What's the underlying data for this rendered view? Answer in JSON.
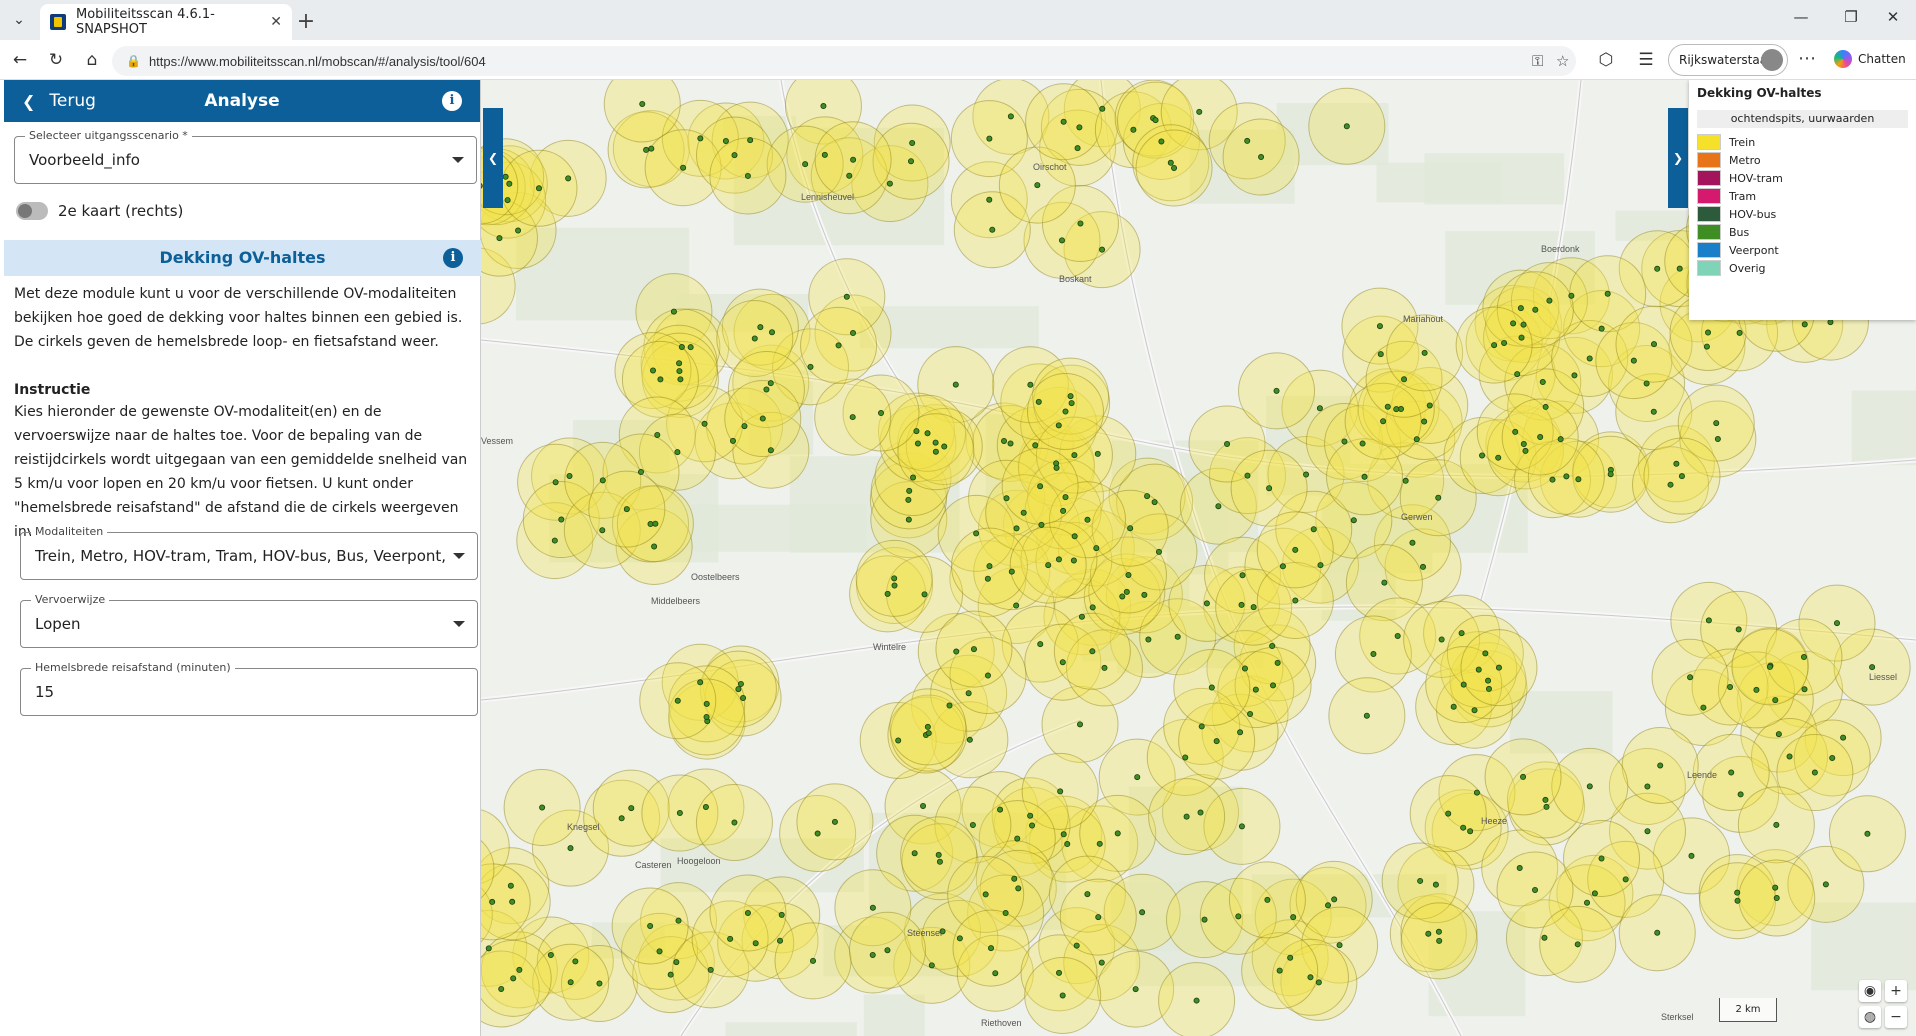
{
  "browser": {
    "tab_title": "Mobiliteitsscan 4.6.1-SNAPSHOT",
    "url": "https://www.mobiliteitsscan.nl/mobscan/#/analysis/tool/604",
    "profile_name": "Rijkswaterstaat",
    "chat_label": "Chatten"
  },
  "panel": {
    "back_label": "Terug",
    "title": "Analyse",
    "scenario_label": "Selecteer uitgangsscenario *",
    "scenario_value": "Voorbeeld_info",
    "second_map_label": "2e kaart (rechts)",
    "section_title": "Dekking OV-haltes",
    "intro": "Met deze module kunt u voor de verschillende OV-modaliteiten bekijken hoe goed de dekking voor haltes binnen een gebied is. De cirkels geven de hemelsbrede loop- en fietsafstand weer.",
    "instructie_heading": "Instructie",
    "instructie_text": "Kies hieronder de gewenste OV-modaliteit(en) en de vervoerswijze naar de haltes toe. Voor de bepaling van de reistijdcirkels wordt uitgegaan van een gemiddelde snelheid van 5 km/u voor lopen en 20 km/u voor fietsen. U kunt onder \"hemelsbrede reisafstand\" de afstand die de cirkels weergeven invoeren.",
    "modaliteiten_label": "Modaliteiten",
    "modaliteiten_value": "Trein, Metro, HOV-tram, Tram, HOV-bus, Bus, Veerpont, ...",
    "vervoerwijze_label": "Vervoerwijze",
    "vervoerwijze_value": "Lopen",
    "reisafstand_label": "Hemelsbrede reisafstand (minuten)",
    "reisafstand_value": "15"
  },
  "legend": {
    "title": "Dekking OV-haltes",
    "subtitle": "ochtendspits, uurwaarden",
    "items": [
      {
        "label": "Trein",
        "color": "#f5e02a"
      },
      {
        "label": "Metro",
        "color": "#e8741a"
      },
      {
        "label": "HOV-tram",
        "color": "#a3145c"
      },
      {
        "label": "Tram",
        "color": "#d4196e"
      },
      {
        "label": "HOV-bus",
        "color": "#2d5a3a"
      },
      {
        "label": "Bus",
        "color": "#3e8e23"
      },
      {
        "label": "Veerpont",
        "color": "#1a7fc9"
      },
      {
        "label": "Overig",
        "color": "#7fd4b8"
      }
    ]
  },
  "map": {
    "scale_label": "2 km",
    "places": [
      "Oirschot",
      "Lennisheuvel",
      "Boskant",
      "Boerdonk",
      "Mariahout",
      "Oostelbeers",
      "Middelbeers",
      "Wintelre",
      "Gerwen",
      "Knegsel",
      "Riethoven",
      "Steensel",
      "Heeze",
      "Leende",
      "Sterksel",
      "Vessem",
      "Hoogeloon",
      "Casteren",
      "Liessel"
    ]
  }
}
